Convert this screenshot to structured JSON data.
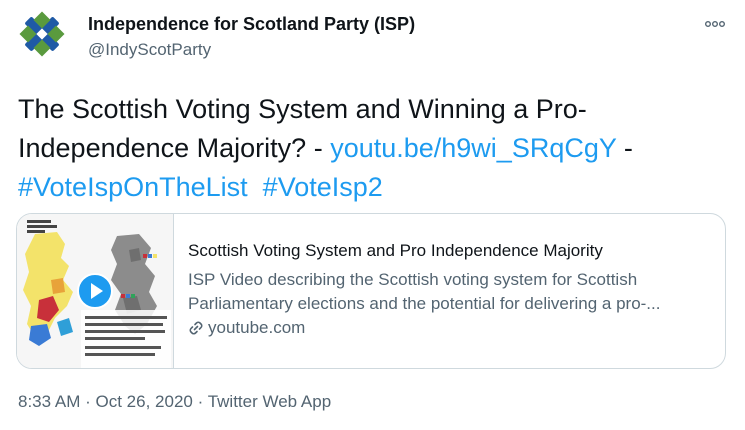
{
  "author": {
    "display_name": "Independence for Scotland Party (ISP)",
    "handle": "@IndyScotParty",
    "avatar_icon": "saltire-knot-logo-icon"
  },
  "more_icon": "more-options-icon",
  "tweet": {
    "text_prefix": "The Scottish Voting System and Winning a Pro-Independence Majority? - ",
    "link": "youtu.be/h9wi_SRqCgY",
    "separator": " - ",
    "hashtags": [
      "#VoteIspOnTheList",
      "#VoteIsp2"
    ]
  },
  "card": {
    "title": "Scottish Voting System and Pro Independence Majority",
    "description_lines": [
      "ISP Video describing the Scottish voting system for Scottish",
      "Parliamentary elections and the potential for delivering a pro-..."
    ],
    "domain": "youtube.com",
    "link_icon": "link-icon",
    "thumbnail_icon": "video-play-icon"
  },
  "meta": {
    "time": "8:33 AM",
    "date": "Oct 26, 2020",
    "source": "Twitter Web App",
    "dot": "·"
  },
  "colors": {
    "link": "#1d9bf0",
    "secondary_text": "#536471",
    "border": "#cfd9de",
    "avatar_blue": "#1f5aa6",
    "avatar_green": "#5a9a3e"
  }
}
